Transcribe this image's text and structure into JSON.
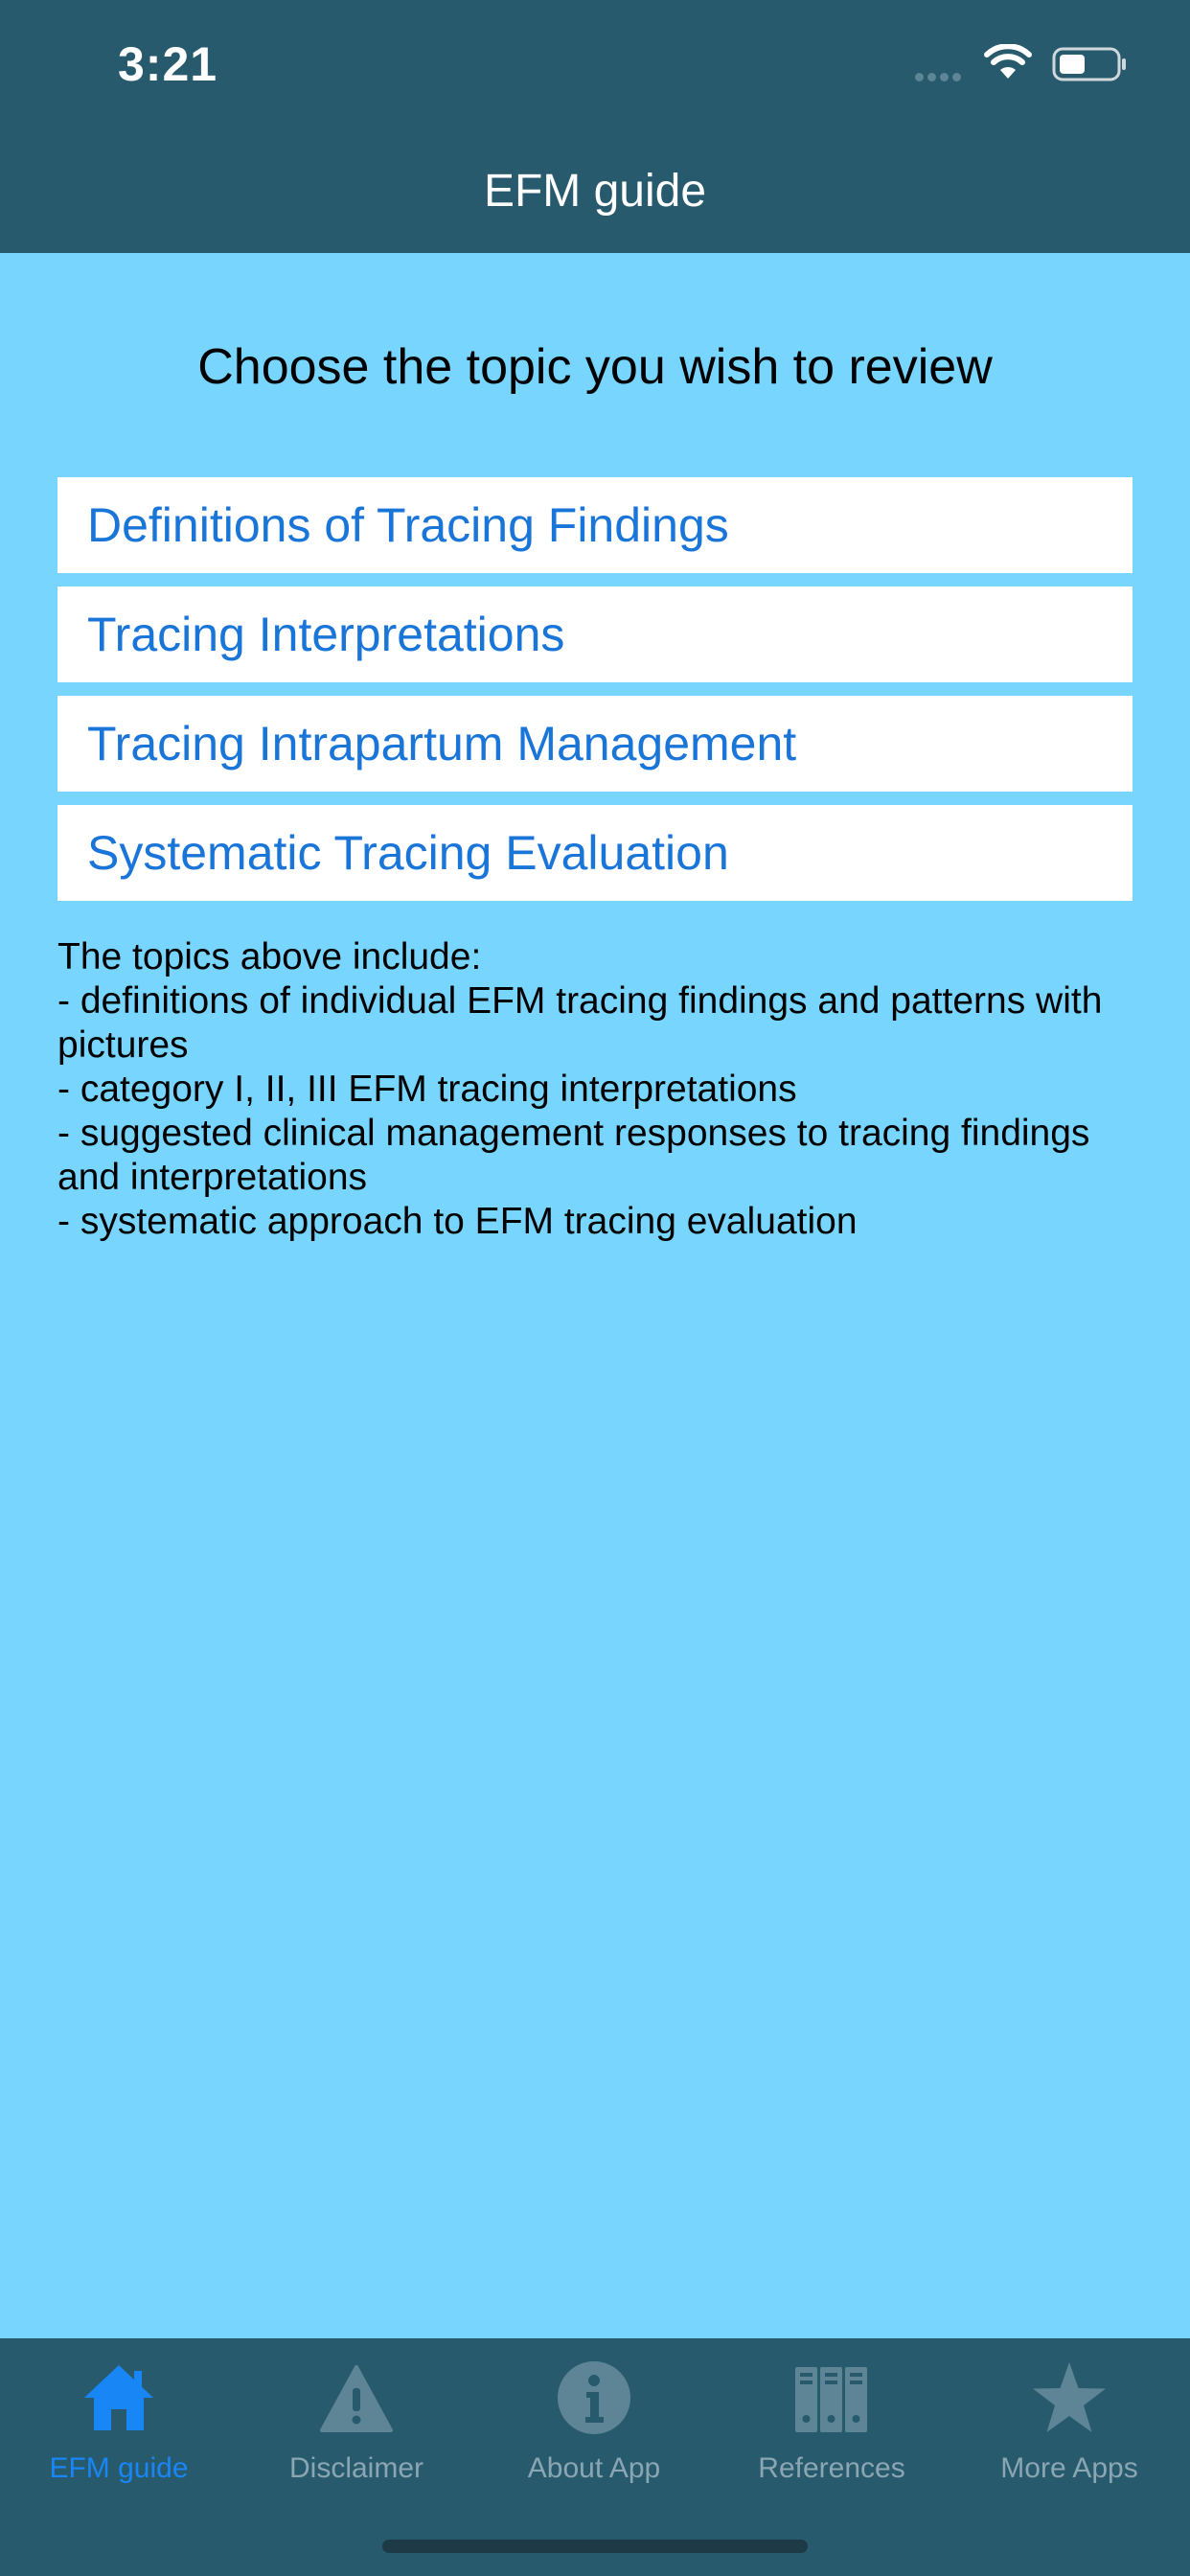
{
  "status_bar": {
    "time": "3:21"
  },
  "nav": {
    "title": "EFM guide"
  },
  "main": {
    "prompt": "Choose the topic you wish to review",
    "topics": [
      "Definitions of Tracing Findings",
      "Tracing Interpretations",
      "Tracing Intrapartum Management",
      "Systematic Tracing Evaluation"
    ],
    "description": [
      "The topics above include:",
      "- definitions of individual EFM tracing findings and patterns with pictures",
      "- category I, II, III EFM tracing interpretations",
      "- suggested clinical management responses to tracing findings and interpretations",
      "- systematic approach to EFM tracing evaluation"
    ]
  },
  "tabs": [
    {
      "label": "EFM guide",
      "icon": "home-icon",
      "active": true
    },
    {
      "label": "Disclaimer",
      "icon": "warning-icon",
      "active": false
    },
    {
      "label": "About App",
      "icon": "info-icon",
      "active": false
    },
    {
      "label": "References",
      "icon": "binders-icon",
      "active": false
    },
    {
      "label": "More Apps",
      "icon": "star-icon",
      "active": false
    }
  ],
  "colors": {
    "bar_background": "#285a6e",
    "page_background": "#78d5fe",
    "link_text": "#1a75d8",
    "tab_active": "#1886f5",
    "tab_inactive": "#8aa6b2"
  }
}
